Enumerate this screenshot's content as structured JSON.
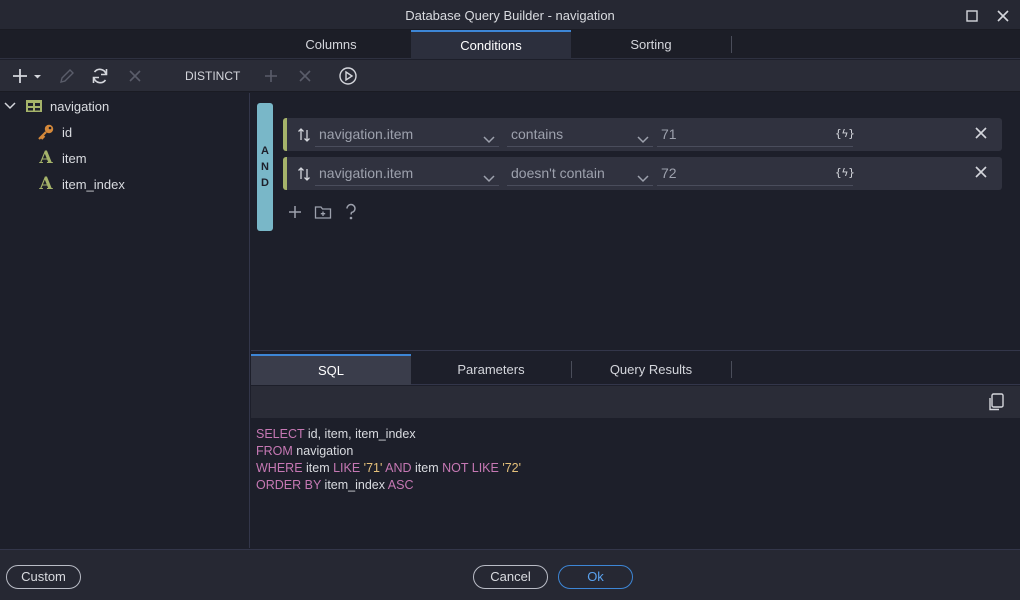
{
  "window": {
    "title": "Database Query Builder - navigation"
  },
  "main_tabs": [
    {
      "label": "Columns",
      "active": false
    },
    {
      "label": "Conditions",
      "active": true
    },
    {
      "label": "Sorting",
      "active": false
    }
  ],
  "toolbar": {
    "distinct_label": "DISTINCT"
  },
  "tree": {
    "table": "navigation",
    "columns": [
      {
        "name": "id",
        "icon": "key-icon"
      },
      {
        "name": "item",
        "icon": "text-type-icon"
      },
      {
        "name": "item_index",
        "icon": "text-type-icon"
      }
    ]
  },
  "conditions": {
    "group_operator": "AND",
    "rows": [
      {
        "field": "navigation.item",
        "operator": "contains",
        "value": "71",
        "dynamic_label": "{ϟ}"
      },
      {
        "field": "navigation.item",
        "operator": "doesn't contain",
        "value": "72",
        "dynamic_label": "{ϟ}"
      }
    ]
  },
  "lower_tabs": [
    {
      "label": "SQL",
      "active": true
    },
    {
      "label": "Parameters",
      "active": false
    },
    {
      "label": "Query Results",
      "active": false
    }
  ],
  "sql": {
    "line1": {
      "kw1": "SELECT",
      "rest": " id, item, item_index"
    },
    "line2": {
      "kw1": "FROM",
      "rest": " navigation"
    },
    "line3": {
      "kw1": "WHERE",
      "t1": " item ",
      "kw2": "LIKE",
      "s1": " '71'",
      "kw3": " AND",
      "t2": " item ",
      "kw4": "NOT LIKE",
      "s2": " '72'"
    },
    "line4": {
      "kw1": "ORDER BY",
      "t1": " item_index ",
      "kw2": "ASC"
    }
  },
  "footer": {
    "custom_label": "Custom",
    "cancel_label": "Cancel",
    "ok_label": "Ok"
  },
  "colors": {
    "accent": "#3d86d6",
    "and_bar": "#79b7c8",
    "keyword": "#c678b4",
    "string": "#e4c07a",
    "field_accent": "#a5b36a"
  }
}
